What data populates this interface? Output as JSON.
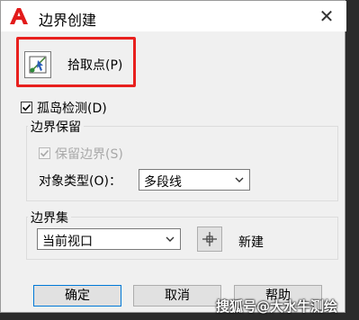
{
  "window": {
    "title": "边界创建",
    "close_symbol": "✕"
  },
  "pick_points": {
    "label": "拾取点(P)"
  },
  "island_detect": {
    "label": "孤岛检测(D)",
    "checked": true
  },
  "boundary_retention": {
    "group_title": "边界保留",
    "keep_boundary": {
      "label": "保留边界(S)",
      "checked": true,
      "disabled": true
    },
    "object_type": {
      "label": "对象类型(O)：",
      "value": "多段线"
    }
  },
  "boundary_set": {
    "group_title": "边界集",
    "value": "当前视口",
    "new_label": "新建"
  },
  "buttons": {
    "ok": "确定",
    "cancel": "取消",
    "help": "帮助"
  },
  "watermark": "搜狐号@大水牛测绘",
  "colors": {
    "highlight": "#e8201e",
    "app_icon": "#e21a1a"
  }
}
